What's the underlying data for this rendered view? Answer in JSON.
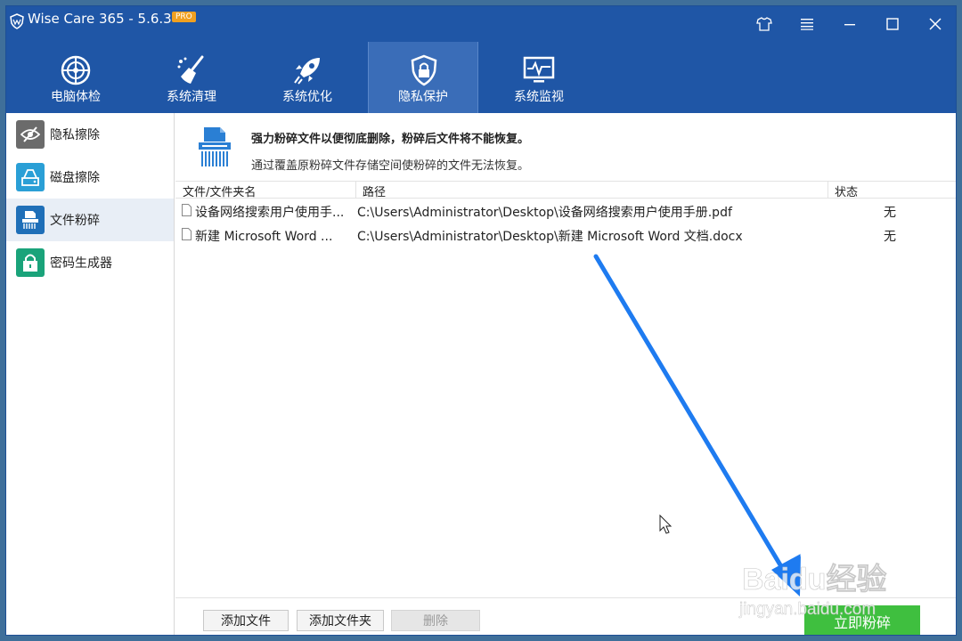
{
  "app": {
    "title": "Wise Care 365 - 5.6.3",
    "badge": "PRO"
  },
  "nav": {
    "tabs": [
      {
        "label": "电脑体检",
        "icon": "radar-icon"
      },
      {
        "label": "系统清理",
        "icon": "broom-icon"
      },
      {
        "label": "系统优化",
        "icon": "rocket-icon"
      },
      {
        "label": "隐私保护",
        "icon": "privacy-shield-icon",
        "active": true
      },
      {
        "label": "系统监视",
        "icon": "monitor-icon"
      }
    ]
  },
  "sidebar": {
    "items": [
      {
        "label": "隐私擦除",
        "icon": "eye-slash-icon",
        "color": "#6b6b6b"
      },
      {
        "label": "磁盘擦除",
        "icon": "disk-icon",
        "color": "#2a9fd6"
      },
      {
        "label": "文件粉碎",
        "icon": "shredder-icon",
        "color": "#1f6fb8",
        "active": true
      },
      {
        "label": "密码生成器",
        "icon": "lock-icon",
        "color": "#1aa37a"
      }
    ]
  },
  "header": {
    "title": "强力粉碎文件以便彻底删除，粉碎后文件将不能恢复。",
    "description": "通过覆盖原粉碎文件存储空间使粉碎的文件无法恢复。"
  },
  "table": {
    "columns": [
      "文件/文件夹名",
      "路径",
      "状态"
    ],
    "rows": [
      {
        "name": "设备网络搜索用户使用手...",
        "path": "C:\\Users\\Administrator\\Desktop\\设备网络搜索用户使用手册.pdf",
        "status": "无"
      },
      {
        "name": "新建 Microsoft Word ...",
        "path": "C:\\Users\\Administrator\\Desktop\\新建 Microsoft Word 文档.docx",
        "status": "无"
      }
    ]
  },
  "footer": {
    "add_file": "添加文件",
    "add_folder": "添加文件夹",
    "delete": "删除",
    "shred_now": "立即粉碎"
  },
  "watermark": {
    "text": "Baidu经验",
    "subtext": "jingyan.baidu.com"
  },
  "colors": {
    "titlebar": "#1f56a6",
    "active_tab": "#3a6db8",
    "shred_button": "#3fbf3f",
    "arrow": "#1e7bf0"
  }
}
